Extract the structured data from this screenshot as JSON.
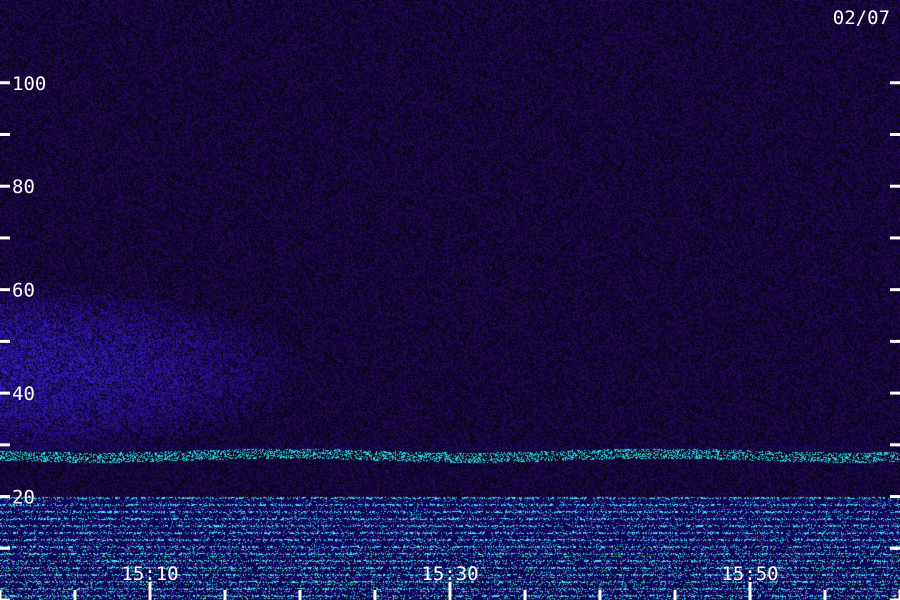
{
  "chart_data": {
    "type": "heatmap",
    "date_label": "02/07",
    "y_axis": {
      "range": [
        0,
        116
      ],
      "labeled_ticks": [
        {
          "value": 20,
          "label": "20"
        },
        {
          "value": 40,
          "label": "40"
        },
        {
          "value": 60,
          "label": "60"
        },
        {
          "value": 80,
          "label": "80"
        },
        {
          "value": 100,
          "label": "100"
        }
      ],
      "minor_ticks": [
        0,
        10,
        30,
        50,
        70,
        90
      ]
    },
    "x_axis": {
      "range_minutes": [
        15.0,
        75.0
      ],
      "labeled_ticks": [
        {
          "value": 10,
          "label": "15:10"
        },
        {
          "value": 30,
          "label": "15:30"
        },
        {
          "value": 50,
          "label": "15:50"
        }
      ],
      "minor_ticks": [
        0,
        5,
        15,
        20,
        25,
        35,
        40,
        45,
        55,
        60
      ]
    },
    "colors": {
      "background_noise": "#1a0d55",
      "low_noise": "#0a0530",
      "enhanced_region": "#2a2ad0",
      "band_cyan": "#40e0e0",
      "band_green": "#60e060",
      "axis": "#ffffff"
    }
  }
}
